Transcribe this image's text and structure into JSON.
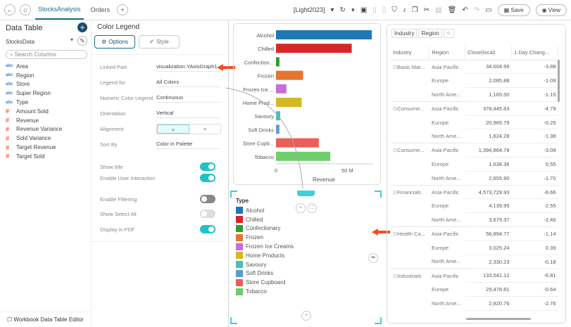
{
  "topbar": {
    "tabs": [
      "StocksAnalysis",
      "Orders"
    ],
    "theme": "[Light2023]",
    "save": "Save",
    "view": "View"
  },
  "left": {
    "title": "Data Table",
    "datasource": "StocksData",
    "search_placeholder": "Search Columns",
    "columns": [
      {
        "type": "abc",
        "name": "Area"
      },
      {
        "type": "abc",
        "name": "Region"
      },
      {
        "type": "abc",
        "name": "Store"
      },
      {
        "type": "abc",
        "name": "Super Region"
      },
      {
        "type": "abc",
        "name": "Type"
      },
      {
        "type": "#",
        "name": "Amount Sold"
      },
      {
        "type": "#",
        "name": "Revenue"
      },
      {
        "type": "#",
        "name": "Revenue Variance"
      },
      {
        "type": "#",
        "name": "Sold Variance"
      },
      {
        "type": "#",
        "name": "Target Revenue"
      },
      {
        "type": "#",
        "name": "Target Sold"
      }
    ],
    "footer": "Workbook Data Table Editor"
  },
  "props": {
    "title": "Color Legend",
    "options": "Options",
    "style": "Style",
    "linked_part_label": "Linked Part",
    "linked_part": "visualization.YAxisGraph1",
    "legend_for_label": "Legend for",
    "legend_for": "All Colors",
    "numeric_label": "Numeric Color Legend",
    "numeric": "Continuous",
    "orientation_label": "Orientation",
    "orientation": "Vertical",
    "alignment_label": "Alignment",
    "sort_label": "Sort By",
    "sort": "Color in Palette",
    "toggles": [
      {
        "label": "Show title",
        "state": "on"
      },
      {
        "label": "Enable User Interaction",
        "state": "on"
      },
      {
        "label": "Enable Filtering",
        "state": "off"
      },
      {
        "label": "Show Select All",
        "state": "disabled"
      },
      {
        "label": "Display in PDF",
        "state": "on"
      }
    ]
  },
  "chart_data": {
    "type": "bar",
    "orientation": "horizontal",
    "categories": [
      "Alcohol",
      "Chilled",
      "Confection...",
      "Frozen",
      "Frozen Ice ...",
      "Home Prod...",
      "Savoury",
      "Soft Drinks",
      "Store Cupb...",
      "Tobacco"
    ],
    "values": [
      67,
      53,
      2.4,
      19,
      7.3,
      18,
      3,
      2.4,
      30,
      38
    ],
    "unit": "M",
    "xlabel": "Revenue",
    "xticks": [
      "0",
      "50 M"
    ],
    "xlim": [
      0,
      68
    ],
    "colors": [
      "#1f77b4",
      "#d62728",
      "#2ca02c",
      "#e67530",
      "#c86dd7",
      "#d4b823",
      "#45bfc0",
      "#5a9bd5",
      "#eb5e5a",
      "#6dcf6a"
    ]
  },
  "legend": {
    "title": "Type",
    "items": [
      "Alcohol",
      "Chilled",
      "Confectionary",
      "Frozen",
      "Frozen Ice Creams",
      "Home Products",
      "Savoury",
      "Soft Drinks",
      "Store Cupboard",
      "Tobacco"
    ]
  },
  "table": {
    "chips": [
      "Industry",
      "Region"
    ],
    "headers": [
      "Industry",
      "Region",
      "Close(local)",
      "1 Day Chang..."
    ],
    "groups": [
      {
        "name": "Basic Mat...",
        "rows": [
          [
            "Asia Pacific",
            "34,604.99",
            "-3.88"
          ],
          [
            "Europe",
            "2,085.88",
            "-1.09"
          ],
          [
            "North Ame...",
            "1,165.50",
            "-1.15"
          ]
        ]
      },
      {
        "name": "Consume...",
        "rows": [
          [
            "Asia Pacific",
            "378,445.83",
            "-4.79"
          ],
          [
            "Europe",
            "20,965.79",
            "-0.25"
          ],
          [
            "North Ame...",
            "1,624.28",
            "-1.38"
          ]
        ]
      },
      {
        "name": "Consume...",
        "rows": [
          [
            "Asia Pacific",
            "1,394,864.78",
            "-3.08"
          ],
          [
            "Europe",
            "1,638.36",
            "0.55"
          ],
          [
            "North Ame...",
            "2,655.90",
            "-1.70"
          ]
        ]
      },
      {
        "name": "Financials",
        "rows": [
          [
            "Asia Pacific",
            "4,573,729.93",
            "-8.66"
          ],
          [
            "Europe",
            "4,139.95",
            "-2.55"
          ],
          [
            "North Ame...",
            "3,679.37",
            "-2.46"
          ]
        ]
      },
      {
        "name": "Health Ca...",
        "rows": [
          [
            "Asia Pacific",
            "56,894.77",
            "-1.14"
          ],
          [
            "Europe",
            "3,025.24",
            "0.39"
          ],
          [
            "North Ame...",
            "2,330.23",
            "-0.18"
          ]
        ]
      },
      {
        "name": "Industrials",
        "rows": [
          [
            "Asia Pacific",
            "133,541.12",
            "-6.81"
          ],
          [
            "Europe",
            "29,478.81",
            "-0.64"
          ],
          [
            "North Ame...",
            "2,920.76",
            "-2.76"
          ]
        ]
      }
    ]
  }
}
